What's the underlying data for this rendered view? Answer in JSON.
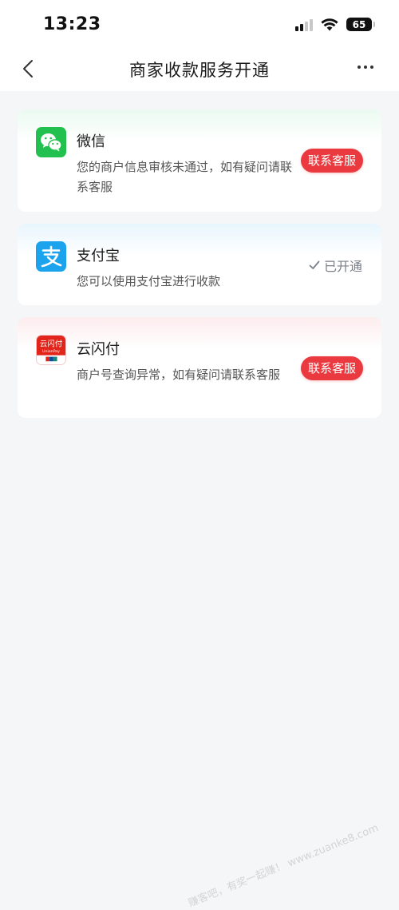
{
  "status_bar": {
    "time": "13:23",
    "battery": "65"
  },
  "nav": {
    "title": "商家收款服务开通",
    "back_icon": "chevron-left-icon",
    "more_icon": "more-horizontal-icon"
  },
  "channels": [
    {
      "name": "微信",
      "description": "您的商户信息审核未通过，如有疑问请联系客服",
      "action_label": "联系客服",
      "icon": "wechat-icon",
      "color": "#22c14f"
    },
    {
      "name": "支付宝",
      "description": "您可以使用支付宝进行收款",
      "status_label": "已开通",
      "icon": "alipay-icon",
      "color": "#1ba3ee"
    },
    {
      "name": "云闪付",
      "description": "商户号查询异常，如有疑问请联系客服",
      "action_label": "联系客服",
      "icon": "unionpay-icon",
      "logo_text": "云闪付",
      "logo_subtext": "UnionPay",
      "color": "#e1251b"
    }
  ],
  "colors": {
    "accent_red": "#ea3a3f",
    "background": "#f5f6f8"
  },
  "watermark": "赚客吧，有奖一起赚！ www.zuanke8.com"
}
